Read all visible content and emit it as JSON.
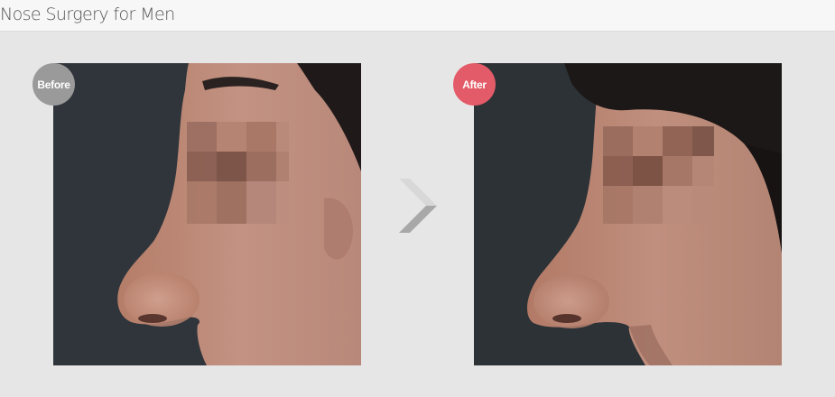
{
  "header": {
    "title": "Nose Surgery for Men"
  },
  "comparison": {
    "before": {
      "label": "Before",
      "badge_color": "#9a9a9a",
      "image": "side-profile-nose-before"
    },
    "after": {
      "label": "After",
      "badge_color": "#e35b68",
      "image": "side-profile-nose-after"
    },
    "divider": {
      "icon": "chevron-right-icon"
    }
  }
}
